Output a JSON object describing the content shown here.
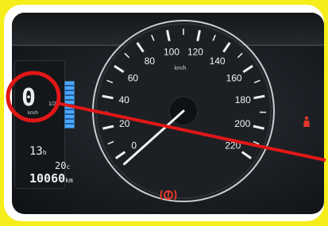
{
  "speedometer": {
    "unit": "km/h",
    "tick_labels": [
      "0",
      "20",
      "40",
      "60",
      "80",
      "100",
      "120",
      "140",
      "160",
      "180",
      "200",
      "220"
    ],
    "needle_value": 0
  },
  "display": {
    "speed": "0",
    "speed_unit": "km/h",
    "side_label": "1/2",
    "range": "13",
    "range_unit": "h",
    "temp": "20",
    "temp_unit": "c",
    "odometer": "10060",
    "odometer_unit": "km"
  },
  "colors": {
    "background": "#f5ee1a",
    "annotation": "#e11717",
    "warning": "#e0392b"
  },
  "icons": [
    "brake-warning-icon",
    "seatbelt-warning-icon"
  ]
}
